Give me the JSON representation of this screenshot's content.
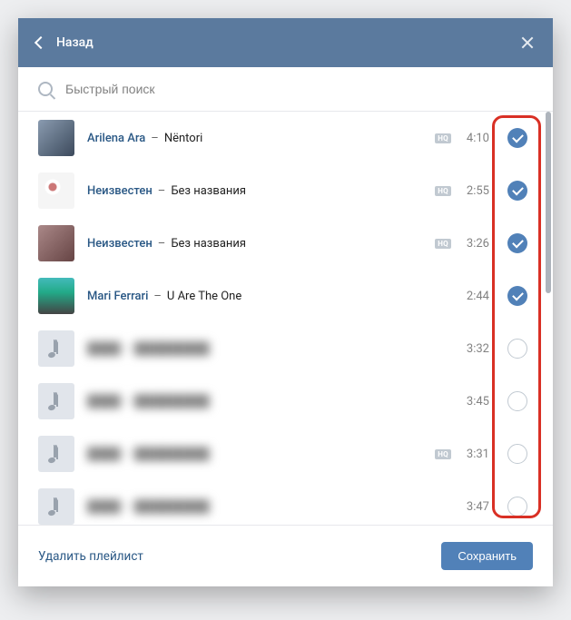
{
  "header": {
    "back_label": "Назад"
  },
  "search": {
    "placeholder": "Быстрый поиск"
  },
  "tracks": [
    {
      "artist": "Arilena Ara",
      "title": "Nëntori",
      "duration": "4:10",
      "hq": true,
      "checked": true,
      "cover": "img1"
    },
    {
      "artist": "Неизвестен",
      "title": "Без названия",
      "duration": "2:55",
      "hq": true,
      "checked": true,
      "cover": "img2"
    },
    {
      "artist": "Неизвестен",
      "title": "Без названия",
      "duration": "3:26",
      "hq": true,
      "checked": true,
      "cover": "img3"
    },
    {
      "artist": "Mari Ferrari",
      "title": "U Are The One",
      "duration": "2:44",
      "hq": false,
      "checked": true,
      "cover": "img4"
    },
    {
      "artist": "",
      "title": "",
      "duration": "3:32",
      "hq": false,
      "checked": false,
      "cover": "note",
      "blurred": true
    },
    {
      "artist": "",
      "title": "",
      "duration": "3:45",
      "hq": false,
      "checked": false,
      "cover": "note",
      "blurred": true
    },
    {
      "artist": "",
      "title": "",
      "duration": "3:31",
      "hq": true,
      "checked": false,
      "cover": "note",
      "blurred": true
    },
    {
      "artist": "",
      "title": "",
      "duration": "3:47",
      "hq": false,
      "checked": false,
      "cover": "note",
      "blurred": true
    }
  ],
  "footer": {
    "delete_label": "Удалить плейлист",
    "save_label": "Сохранить"
  },
  "hq_label": "HQ"
}
